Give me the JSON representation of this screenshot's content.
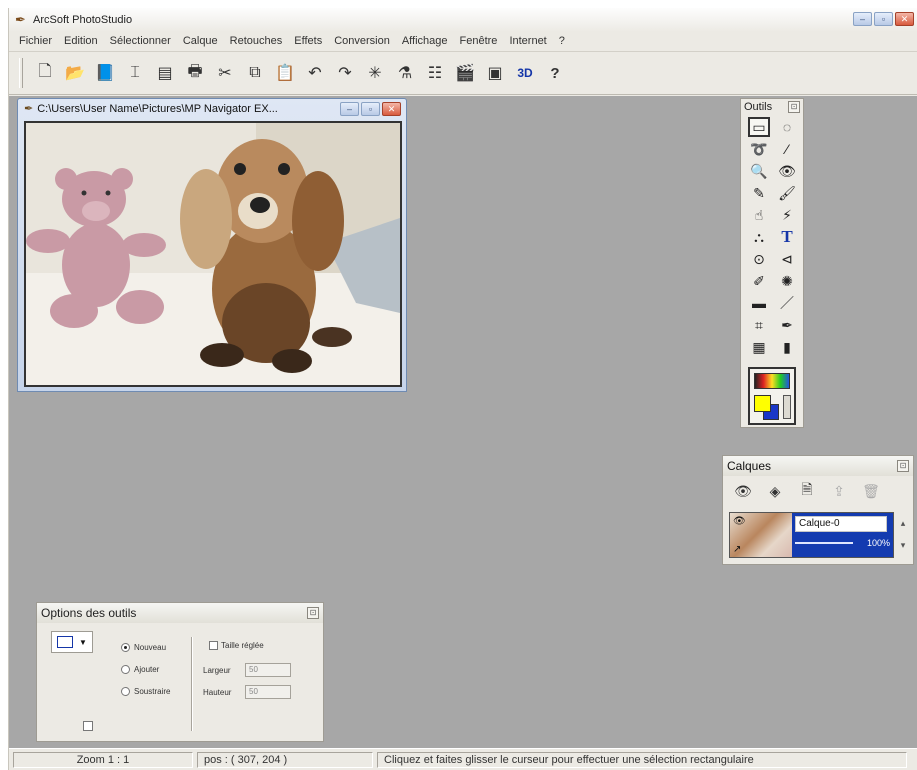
{
  "window": {
    "title": "ArcSoft PhotoStudio"
  },
  "menu": [
    "Fichier",
    "Edition",
    "Sélectionner",
    "Calque",
    "Retouches",
    "Effets",
    "Conversion",
    "Affichage",
    "Fenêtre",
    "Internet",
    "?"
  ],
  "toolbar": {
    "buttons": [
      {
        "name": "new-icon",
        "glyph": "🗋"
      },
      {
        "name": "open-icon",
        "glyph": "📂"
      },
      {
        "name": "album-icon",
        "glyph": "📘"
      },
      {
        "name": "scan-icon",
        "glyph": "⌶"
      },
      {
        "name": "save-icon",
        "glyph": "▤"
      },
      {
        "name": "print-icon",
        "glyph": "🖶"
      },
      {
        "name": "cut-icon",
        "glyph": "✂"
      },
      {
        "name": "copy-icon",
        "glyph": "⧉"
      },
      {
        "name": "paste-icon",
        "glyph": "📋"
      },
      {
        "name": "undo-icon",
        "glyph": "↶"
      },
      {
        "name": "redo-icon",
        "glyph": "↷"
      },
      {
        "name": "magic-icon",
        "glyph": "✳"
      },
      {
        "name": "enhance-icon",
        "glyph": "⚗"
      },
      {
        "name": "compare-icon",
        "glyph": "☷"
      },
      {
        "name": "slideshow-icon",
        "glyph": "🎬"
      },
      {
        "name": "device-icon",
        "glyph": "▣"
      },
      {
        "name": "3d-icon",
        "glyph": "3D"
      },
      {
        "name": "help-icon",
        "glyph": "?"
      }
    ]
  },
  "document": {
    "title": "C:\\Users\\User Name\\Pictures\\MP Navigator EX..."
  },
  "tools_panel": {
    "title": "Outils",
    "tools": [
      {
        "name": "rect-select-tool-icon",
        "glyph": "▭"
      },
      {
        "name": "ellipse-select-tool-icon",
        "glyph": "◌"
      },
      {
        "name": "lasso-tool-icon",
        "glyph": "➰"
      },
      {
        "name": "magic-wand-tool-icon",
        "glyph": "⁄"
      },
      {
        "name": "zoom-tool-icon",
        "glyph": "🔍"
      },
      {
        "name": "red-eye-tool-icon",
        "glyph": "👁"
      },
      {
        "name": "clone-tool-icon",
        "glyph": "✎"
      },
      {
        "name": "brush-tool-icon",
        "glyph": "🖌"
      },
      {
        "name": "smudge-tool-icon",
        "glyph": "☝"
      },
      {
        "name": "fill-tool-icon",
        "glyph": "⚡"
      },
      {
        "name": "bucket-tool-icon",
        "glyph": "⛬"
      },
      {
        "name": "text-tool-icon",
        "glyph": "T"
      },
      {
        "name": "dropper-tool-icon",
        "glyph": "⊙"
      },
      {
        "name": "stamp-tool-icon",
        "glyph": "⊲"
      },
      {
        "name": "pencil-eraser-tool-icon",
        "glyph": "✐"
      },
      {
        "name": "airbrush-tool-icon",
        "glyph": "✺"
      },
      {
        "name": "eraser-tool-icon",
        "glyph": "▬"
      },
      {
        "name": "line-tool-icon",
        "glyph": "／"
      },
      {
        "name": "crop-tool-icon",
        "glyph": "⌗"
      },
      {
        "name": "pen-tool-icon",
        "glyph": "✒"
      },
      {
        "name": "image-tool-icon",
        "glyph": "▦"
      },
      {
        "name": "cylinder-tool-icon",
        "glyph": "▮"
      }
    ]
  },
  "layers_panel": {
    "title": "Calques",
    "layer_name": "Calque-0",
    "opacity": "100%"
  },
  "options_panel": {
    "title": "Options des outils",
    "radios": [
      "Nouveau",
      "Ajouter",
      "Soustraire"
    ],
    "selected_radio": 0,
    "fixed_size_label": "Taille réglée",
    "width_label": "Largeur",
    "width_value": "50",
    "height_label": "Hauteur",
    "height_value": "50"
  },
  "status": {
    "zoom": "Zoom 1 : 1",
    "pos": "pos : ( 307, 204 )",
    "message": "Cliquez et faites glisser le curseur pour effectuer une sélection rectangulaire"
  }
}
